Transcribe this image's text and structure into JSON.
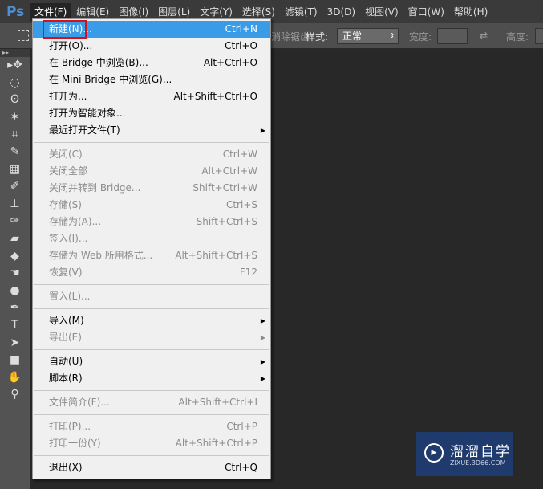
{
  "app": {
    "logo": "Ps"
  },
  "menubar": [
    "文件(F)",
    "编辑(E)",
    "图像(I)",
    "图层(L)",
    "文字(Y)",
    "选择(S)",
    "滤镜(T)",
    "3D(D)",
    "视图(V)",
    "窗口(W)",
    "帮助(H)"
  ],
  "options": {
    "antialias": "消除锯齿",
    "style_label": "样式:",
    "style_value": "正常",
    "width_label": "宽度:",
    "height_label": "高度:"
  },
  "tools": [
    "move",
    "marquee",
    "lasso",
    "magic-wand",
    "crop",
    "eyedropper",
    "healing",
    "brush",
    "stamp",
    "history-brush",
    "eraser",
    "paint-bucket",
    "smudge",
    "dodge",
    "pen",
    "type",
    "path-select",
    "rectangle",
    "hand",
    "zoom"
  ],
  "menu": {
    "groups": [
      [
        {
          "label": "新建(N)...",
          "shortcut": "Ctrl+N",
          "state": "highlighted"
        },
        {
          "label": "打开(O)...",
          "shortcut": "Ctrl+O"
        },
        {
          "label": "在 Bridge 中浏览(B)...",
          "shortcut": "Alt+Ctrl+O"
        },
        {
          "label": "在 Mini Bridge 中浏览(G)...",
          "shortcut": ""
        },
        {
          "label": "打开为...",
          "shortcut": "Alt+Shift+Ctrl+O"
        },
        {
          "label": "打开为智能对象...",
          "shortcut": ""
        },
        {
          "label": "最近打开文件(T)",
          "shortcut": "",
          "submenu": true
        }
      ],
      [
        {
          "label": "关闭(C)",
          "shortcut": "Ctrl+W",
          "state": "disabled"
        },
        {
          "label": "关闭全部",
          "shortcut": "Alt+Ctrl+W",
          "state": "disabled"
        },
        {
          "label": "关闭并转到 Bridge...",
          "shortcut": "Shift+Ctrl+W",
          "state": "disabled"
        },
        {
          "label": "存储(S)",
          "shortcut": "Ctrl+S",
          "state": "disabled"
        },
        {
          "label": "存储为(A)...",
          "shortcut": "Shift+Ctrl+S",
          "state": "disabled"
        },
        {
          "label": "签入(I)...",
          "shortcut": "",
          "state": "disabled"
        },
        {
          "label": "存储为 Web 所用格式...",
          "shortcut": "Alt+Shift+Ctrl+S",
          "state": "disabled"
        },
        {
          "label": "恢复(V)",
          "shortcut": "F12",
          "state": "disabled"
        }
      ],
      [
        {
          "label": "置入(L)...",
          "shortcut": "",
          "state": "disabled"
        }
      ],
      [
        {
          "label": "导入(M)",
          "shortcut": "",
          "submenu": true
        },
        {
          "label": "导出(E)",
          "shortcut": "",
          "submenu": true,
          "state": "disabled"
        }
      ],
      [
        {
          "label": "自动(U)",
          "shortcut": "",
          "submenu": true
        },
        {
          "label": "脚本(R)",
          "shortcut": "",
          "submenu": true
        }
      ],
      [
        {
          "label": "文件简介(F)...",
          "shortcut": "Alt+Shift+Ctrl+I",
          "state": "disabled"
        }
      ],
      [
        {
          "label": "打印(P)...",
          "shortcut": "Ctrl+P",
          "state": "disabled"
        },
        {
          "label": "打印一份(Y)",
          "shortcut": "Alt+Shift+Ctrl+P",
          "state": "disabled"
        }
      ],
      [
        {
          "label": "退出(X)",
          "shortcut": "Ctrl+Q"
        }
      ]
    ]
  },
  "watermark": {
    "title": "溜溜自学",
    "url": "ZIXUE.3D66.COM"
  },
  "colors": {
    "highlight": "#3a9be6",
    "annotation": "#d8121b",
    "watermark": "#1f3a6d"
  }
}
